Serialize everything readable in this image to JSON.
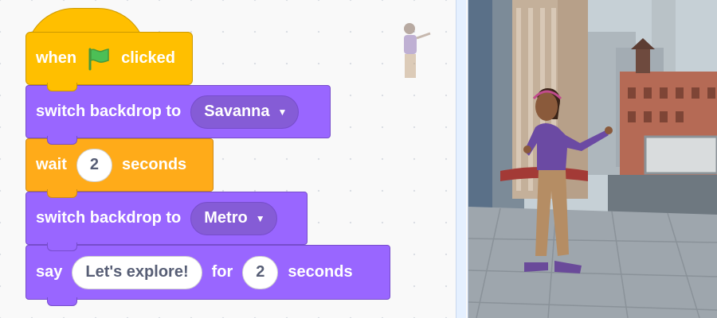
{
  "script": {
    "hat": {
      "word1": "when",
      "icon": "green-flag-icon",
      "word2": "clicked"
    },
    "block1": {
      "label": "switch backdrop to",
      "value": "Savanna"
    },
    "block2": {
      "label1": "wait",
      "value": "2",
      "label2": "seconds"
    },
    "block3": {
      "label": "switch backdrop to",
      "value": "Metro"
    },
    "block4": {
      "label1": "say",
      "message": "Let's explore!",
      "label2": "for",
      "secs": "2",
      "label3": "seconds"
    }
  },
  "colors": {
    "events": "#ffbf00",
    "looks": "#9966ff",
    "control": "#ffab19",
    "flag": "#4cbf56"
  },
  "stage": {
    "backdrop": "city street (Metro)",
    "sprite": "girl character"
  }
}
